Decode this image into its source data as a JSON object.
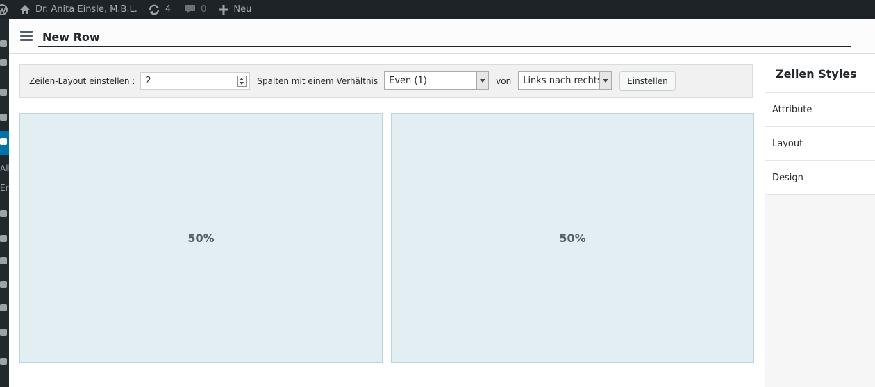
{
  "admin_bar": {
    "site_name": "Dr. Anita Einsle, M.B.L.",
    "updates_count": "4",
    "comments_count": "0",
    "new_label": "Neu"
  },
  "side_menu": {
    "labels": [
      "Alle",
      "Ers"
    ]
  },
  "modal": {
    "title_value": "New Row",
    "toolbar": {
      "layout_label": "Zeilen-Layout einstellen :",
      "columns_value": "2",
      "ratio_label": "Spalten mit einem Verhältnis",
      "ratio_selected": "Even (1)",
      "direction_label": "von",
      "direction_selected": "Links nach rechts",
      "set_button": "Einstellen"
    },
    "columns": [
      {
        "width_label": "50%"
      },
      {
        "width_label": "50%"
      }
    ]
  },
  "sidebar": {
    "title": "Zeilen Styles",
    "items": [
      {
        "label": "Attribute"
      },
      {
        "label": "Layout"
      },
      {
        "label": "Design"
      }
    ]
  }
}
